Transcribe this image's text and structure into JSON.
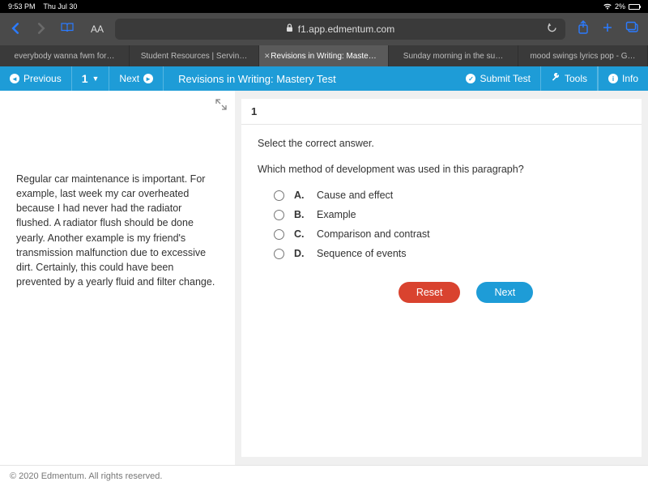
{
  "status": {
    "time": "9:53 PM",
    "date": "Thu Jul 30",
    "battery_pct": "2%"
  },
  "browser": {
    "url_host": "f1.app.edmentum.com",
    "aa": "AA",
    "tabs": [
      "everybody wanna fwm for…",
      "Student Resources | Servin…",
      "Revisions in Writing: Maste…",
      "Sunday morning in the su…",
      "mood swings lyrics pop - G…"
    ],
    "active_tab_index": 2
  },
  "appbar": {
    "previous": "Previous",
    "page_num": "1",
    "next": "Next",
    "title": "Revisions in Writing: Mastery Test",
    "submit": "Submit Test",
    "tools": "Tools",
    "info": "Info"
  },
  "passage": "Regular car maintenance is important. For example, last week my car overheated because I had never had the radiator flushed. A radiator flush should be done yearly. Another example is my friend's transmission malfunction due to excessive dirt. Certainly, this could have been prevented by a yearly fluid and filter change.",
  "question": {
    "number": "1",
    "instruction": "Select the correct answer.",
    "prompt": "Which method of development was used in this paragraph?",
    "choices": [
      {
        "letter": "A.",
        "text": "Cause and effect"
      },
      {
        "letter": "B.",
        "text": "Example"
      },
      {
        "letter": "C.",
        "text": "Comparison and contrast"
      },
      {
        "letter": "D.",
        "text": "Sequence of events"
      }
    ],
    "reset": "Reset",
    "next": "Next"
  },
  "footer": "© 2020 Edmentum. All rights reserved."
}
